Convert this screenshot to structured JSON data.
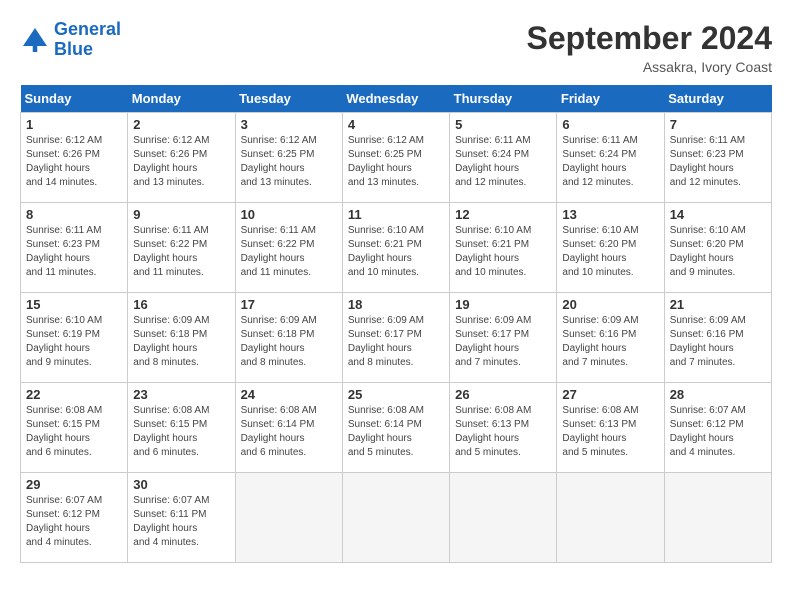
{
  "header": {
    "logo_line1": "General",
    "logo_line2": "Blue",
    "month": "September 2024",
    "location": "Assakra, Ivory Coast"
  },
  "weekdays": [
    "Sunday",
    "Monday",
    "Tuesday",
    "Wednesday",
    "Thursday",
    "Friday",
    "Saturday"
  ],
  "weeks": [
    [
      {
        "day": "1",
        "sunrise": "6:12 AM",
        "sunset": "6:26 PM",
        "daylight": "12 hours and 14 minutes."
      },
      {
        "day": "2",
        "sunrise": "6:12 AM",
        "sunset": "6:26 PM",
        "daylight": "12 hours and 13 minutes."
      },
      {
        "day": "3",
        "sunrise": "6:12 AM",
        "sunset": "6:25 PM",
        "daylight": "12 hours and 13 minutes."
      },
      {
        "day": "4",
        "sunrise": "6:12 AM",
        "sunset": "6:25 PM",
        "daylight": "12 hours and 13 minutes."
      },
      {
        "day": "5",
        "sunrise": "6:11 AM",
        "sunset": "6:24 PM",
        "daylight": "12 hours and 12 minutes."
      },
      {
        "day": "6",
        "sunrise": "6:11 AM",
        "sunset": "6:24 PM",
        "daylight": "12 hours and 12 minutes."
      },
      {
        "day": "7",
        "sunrise": "6:11 AM",
        "sunset": "6:23 PM",
        "daylight": "12 hours and 12 minutes."
      }
    ],
    [
      {
        "day": "8",
        "sunrise": "6:11 AM",
        "sunset": "6:23 PM",
        "daylight": "12 hours and 11 minutes."
      },
      {
        "day": "9",
        "sunrise": "6:11 AM",
        "sunset": "6:22 PM",
        "daylight": "12 hours and 11 minutes."
      },
      {
        "day": "10",
        "sunrise": "6:11 AM",
        "sunset": "6:22 PM",
        "daylight": "12 hours and 11 minutes."
      },
      {
        "day": "11",
        "sunrise": "6:10 AM",
        "sunset": "6:21 PM",
        "daylight": "12 hours and 10 minutes."
      },
      {
        "day": "12",
        "sunrise": "6:10 AM",
        "sunset": "6:21 PM",
        "daylight": "12 hours and 10 minutes."
      },
      {
        "day": "13",
        "sunrise": "6:10 AM",
        "sunset": "6:20 PM",
        "daylight": "12 hours and 10 minutes."
      },
      {
        "day": "14",
        "sunrise": "6:10 AM",
        "sunset": "6:20 PM",
        "daylight": "12 hours and 9 minutes."
      }
    ],
    [
      {
        "day": "15",
        "sunrise": "6:10 AM",
        "sunset": "6:19 PM",
        "daylight": "12 hours and 9 minutes."
      },
      {
        "day": "16",
        "sunrise": "6:09 AM",
        "sunset": "6:18 PM",
        "daylight": "12 hours and 8 minutes."
      },
      {
        "day": "17",
        "sunrise": "6:09 AM",
        "sunset": "6:18 PM",
        "daylight": "12 hours and 8 minutes."
      },
      {
        "day": "18",
        "sunrise": "6:09 AM",
        "sunset": "6:17 PM",
        "daylight": "12 hours and 8 minutes."
      },
      {
        "day": "19",
        "sunrise": "6:09 AM",
        "sunset": "6:17 PM",
        "daylight": "12 hours and 7 minutes."
      },
      {
        "day": "20",
        "sunrise": "6:09 AM",
        "sunset": "6:16 PM",
        "daylight": "12 hours and 7 minutes."
      },
      {
        "day": "21",
        "sunrise": "6:09 AM",
        "sunset": "6:16 PM",
        "daylight": "12 hours and 7 minutes."
      }
    ],
    [
      {
        "day": "22",
        "sunrise": "6:08 AM",
        "sunset": "6:15 PM",
        "daylight": "12 hours and 6 minutes."
      },
      {
        "day": "23",
        "sunrise": "6:08 AM",
        "sunset": "6:15 PM",
        "daylight": "12 hours and 6 minutes."
      },
      {
        "day": "24",
        "sunrise": "6:08 AM",
        "sunset": "6:14 PM",
        "daylight": "12 hours and 6 minutes."
      },
      {
        "day": "25",
        "sunrise": "6:08 AM",
        "sunset": "6:14 PM",
        "daylight": "12 hours and 5 minutes."
      },
      {
        "day": "26",
        "sunrise": "6:08 AM",
        "sunset": "6:13 PM",
        "daylight": "12 hours and 5 minutes."
      },
      {
        "day": "27",
        "sunrise": "6:08 AM",
        "sunset": "6:13 PM",
        "daylight": "12 hours and 5 minutes."
      },
      {
        "day": "28",
        "sunrise": "6:07 AM",
        "sunset": "6:12 PM",
        "daylight": "12 hours and 4 minutes."
      }
    ],
    [
      {
        "day": "29",
        "sunrise": "6:07 AM",
        "sunset": "6:12 PM",
        "daylight": "12 hours and 4 minutes."
      },
      {
        "day": "30",
        "sunrise": "6:07 AM",
        "sunset": "6:11 PM",
        "daylight": "12 hours and 4 minutes."
      },
      null,
      null,
      null,
      null,
      null
    ]
  ]
}
